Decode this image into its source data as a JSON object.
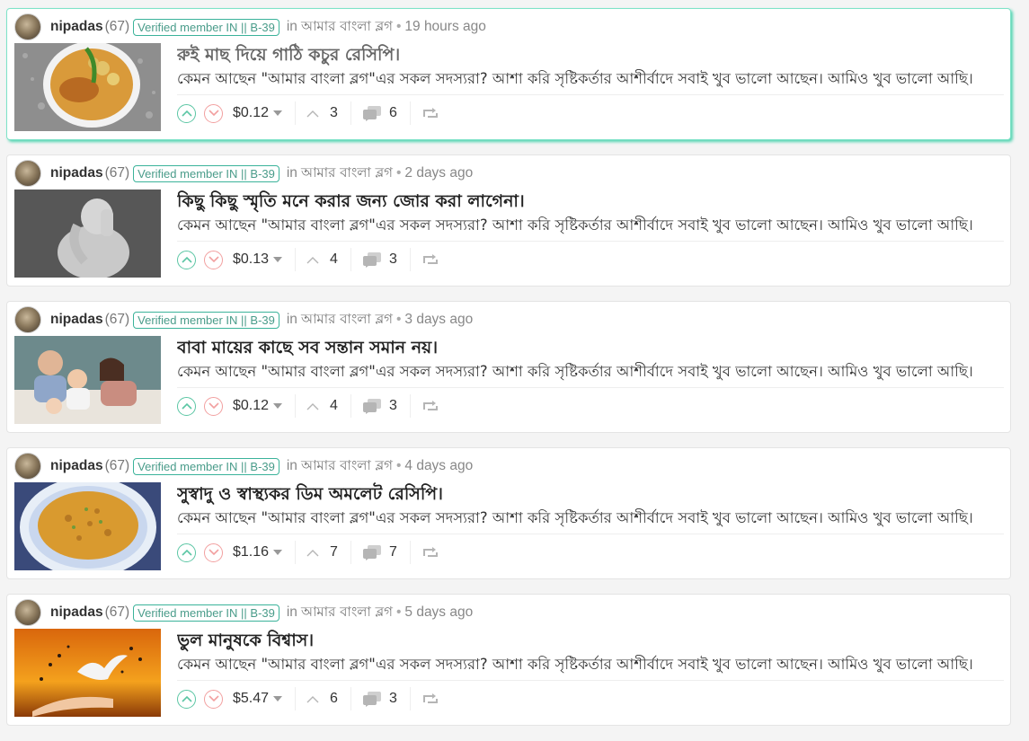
{
  "posts": [
    {
      "author": "nipadas",
      "reputation": "(67)",
      "badge": "Verified member IN || B-39",
      "in_label": "in",
      "community": "আমার বাংলা ব্লগ",
      "separator": "•",
      "age": "19 hours ago",
      "title": "রুই মাছ দিয়ে গাঠি কচুর রেসিপি।",
      "excerpt": "কেমন আছেন \"আমার বাংলা ব্লগ\"এর সকল সদস্যরা? আশা করি সৃষ্টিকর্তার আশীর্বাদে সবাই খুব ভালো আছেন। আমিও খুব ভালো আছি।",
      "payout": "$0.12",
      "votes": "3",
      "comments": "6",
      "thumb": "fish-curry"
    },
    {
      "author": "nipadas",
      "reputation": "(67)",
      "badge": "Verified member IN || B-39",
      "in_label": "in",
      "community": "আমার বাংলা ব্লগ",
      "separator": "•",
      "age": "2 days ago",
      "title": "কিছু কিছু স্মৃতি মনে করার জন্য জোর করা লাগেনা।",
      "excerpt": "কেমন আছেন \"আমার বাংলা ব্লগ\"এর সকল সদস্যরা? আশা করি সৃষ্টিকর্তার আশীর্বাদে সবাই খুব ভালো আছেন। আমিও খুব ভালো আছি।",
      "payout": "$0.13",
      "votes": "4",
      "comments": "3",
      "thumb": "statue"
    },
    {
      "author": "nipadas",
      "reputation": "(67)",
      "badge": "Verified member IN || B-39",
      "in_label": "in",
      "community": "আমার বাংলা ব্লগ",
      "separator": "•",
      "age": "3 days ago",
      "title": "বাবা মায়ের কাছে সব সন্তান সমান নয়।",
      "excerpt": "কেমন আছেন \"আমার বাংলা ব্লগ\"এর সকল সদস্যরা? আশা করি সৃষ্টিকর্তার আশীর্বাদে সবাই খুব ভালো আছেন। আমিও খুব ভালো আছি।",
      "payout": "$0.12",
      "votes": "4",
      "comments": "3",
      "thumb": "family"
    },
    {
      "author": "nipadas",
      "reputation": "(67)",
      "badge": "Verified member IN || B-39",
      "in_label": "in",
      "community": "আমার বাংলা ব্লগ",
      "separator": "•",
      "age": "4 days ago",
      "title": "সুস্বাদু ও স্বাস্থ্যকর ডিম অমলেট রেসিপি।",
      "excerpt": "কেমন আছেন \"আমার বাংলা ব্লগ\"এর সকল সদস্যরা? আশা করি সৃষ্টিকর্তার আশীর্বাদে সবাই খুব ভালো আছেন। আমিও খুব ভালো আছি।",
      "payout": "$1.16",
      "votes": "7",
      "comments": "7",
      "thumb": "omelette"
    },
    {
      "author": "nipadas",
      "reputation": "(67)",
      "badge": "Verified member IN || B-39",
      "in_label": "in",
      "community": "আমার বাংলা ব্লগ",
      "separator": "•",
      "age": "5 days ago",
      "title": "ভুল মানুষকে বিশ্বাস।",
      "excerpt": "কেমন আছেন \"আমার বাংলা ব্লগ\"এর সকল সদস্যরা? আশা করি সৃষ্টিকর্তার আশীর্বাদে সবাই খুব ভালো আছেন। আমিও খুব ভালো আছি।",
      "payout": "$5.47",
      "votes": "6",
      "comments": "3",
      "thumb": "dove-sunset"
    }
  ],
  "colors": {
    "upvote": "#5bc6a4",
    "downvote": "#f2a0a0",
    "active_border": "#4fd3b0",
    "icon_gray": "#b5b5b5"
  },
  "icons": {
    "upvote": "chevron-up-circle-icon",
    "downvote": "chevron-down-circle-icon",
    "votes": "caret-up-icon",
    "comments": "comments-icon",
    "reblog": "reblog-icon"
  }
}
